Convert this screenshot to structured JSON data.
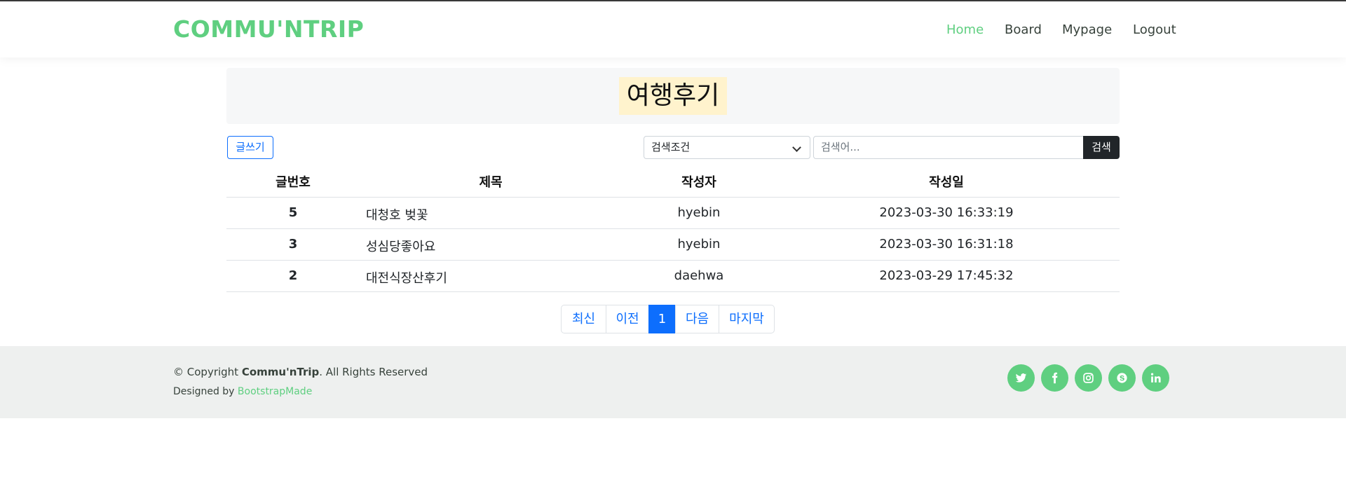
{
  "header": {
    "logo": "COMMU'NTRIP",
    "nav": [
      {
        "label": "Home",
        "active": true
      },
      {
        "label": "Board",
        "active": false
      },
      {
        "label": "Mypage",
        "active": false
      },
      {
        "label": "Logout",
        "active": false
      }
    ]
  },
  "page": {
    "title": "여행후기"
  },
  "toolbar": {
    "write_label": "글쓰기",
    "select_value": "검색조건",
    "search_placeholder": "검색어...",
    "search_label": "검색"
  },
  "table": {
    "columns": [
      "글번호",
      "제목",
      "작성자",
      "작성일"
    ],
    "rows": [
      {
        "no": "5",
        "title": "대청호 벚꽃",
        "author": "hyebin",
        "date": "2023-03-30 16:33:19"
      },
      {
        "no": "3",
        "title": "성심당좋아요",
        "author": "hyebin",
        "date": "2023-03-30 16:31:18"
      },
      {
        "no": "2",
        "title": "대전식장산후기",
        "author": "daehwa",
        "date": "2023-03-29 17:45:32"
      }
    ]
  },
  "pagination": {
    "first": "최신",
    "prev": "이전",
    "current": "1",
    "next": "다음",
    "last": "마지막"
  },
  "footer": {
    "copyright_prefix": "© Copyright ",
    "brand": "Commu'nTrip",
    "copyright_suffix": ". All Rights Reserved",
    "designed_prefix": "Designed by ",
    "designed_link": "BootstrapMade",
    "social": [
      "twitter-icon",
      "facebook-icon",
      "instagram-icon",
      "skype-icon",
      "linkedin-icon"
    ]
  },
  "colors": {
    "brand": "#5fcf80",
    "primary": "#0d6efd",
    "title_highlight": "#fff3cd",
    "footer_bg": "#eef0ef"
  }
}
